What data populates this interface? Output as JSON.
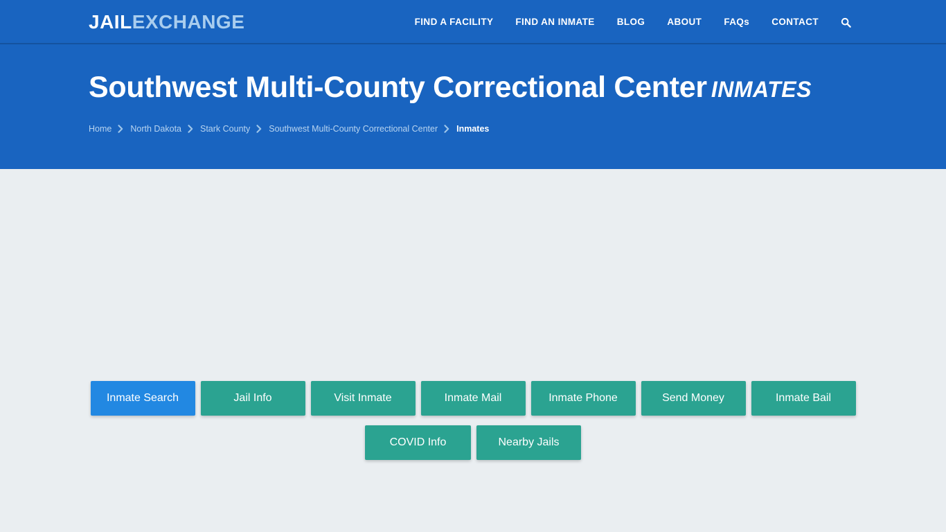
{
  "site": {
    "brand_part1": "JAIL",
    "brand_part2": "EXCHANGE",
    "colors": {
      "header_blue": "#1964c0",
      "header_border": "#14539f",
      "body_background": "#eaeef1",
      "button_teal": "#2ba391",
      "button_active_blue": "#2288e2",
      "brand_light": "#a9cdee",
      "breadcrumb_link": "#b8d4f0"
    }
  },
  "nav": {
    "items": [
      {
        "label": "FIND A FACILITY",
        "name": "nav-item-find-a-facility"
      },
      {
        "label": "FIND AN INMATE",
        "name": "nav-item-find-an-inmate"
      },
      {
        "label": "BLOG",
        "name": "nav-item-blog"
      },
      {
        "label": "ABOUT",
        "name": "nav-item-about"
      },
      {
        "label": "FAQs",
        "name": "nav-item-faqs"
      },
      {
        "label": "CONTACT",
        "name": "nav-item-contact"
      }
    ],
    "search_icon": "search-icon"
  },
  "hero": {
    "title": "Southwest Multi-County Correctional Center",
    "title_suffix": "INMATES",
    "breadcrumb": {
      "separator_icon": "chevron-right-icon",
      "items": [
        {
          "label": "Home",
          "current": false
        },
        {
          "label": "North Dakota",
          "current": false
        },
        {
          "label": "Stark County",
          "current": false
        },
        {
          "label": "Southwest Multi-County Correctional Center",
          "current": false
        },
        {
          "label": "Inmates",
          "current": true
        }
      ]
    }
  },
  "facility_nav": {
    "row1": [
      {
        "label": "Inmate Search",
        "active": true
      },
      {
        "label": "Jail Info",
        "active": false
      },
      {
        "label": "Visit Inmate",
        "active": false
      },
      {
        "label": "Inmate Mail",
        "active": false
      },
      {
        "label": "Inmate Phone",
        "active": false
      },
      {
        "label": "Send Money",
        "active": false
      },
      {
        "label": "Inmate Bail",
        "active": false
      }
    ],
    "row2": [
      {
        "label": "COVID Info",
        "active": false
      },
      {
        "label": "Nearby Jails",
        "active": false
      }
    ]
  }
}
